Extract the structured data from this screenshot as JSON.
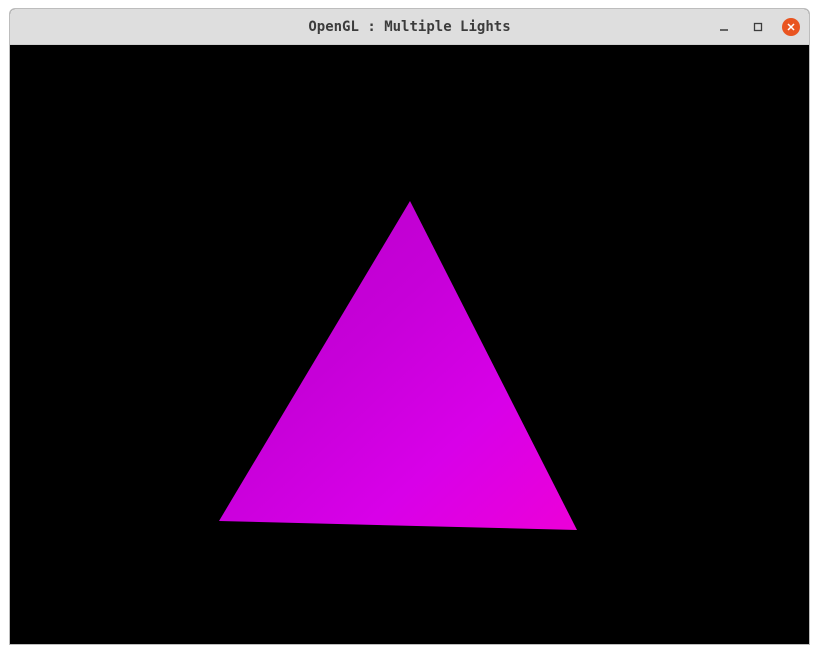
{
  "window": {
    "title": "OpenGL : Multiple Lights"
  },
  "controls": {
    "minimize_icon": "minimize-icon",
    "maximize_icon": "maximize-icon",
    "close_icon": "close-icon"
  },
  "scene": {
    "background_color": "#000000",
    "triangle_gradient": [
      "#b800c8",
      "#c600d8",
      "#d800e8",
      "#ec00d8"
    ]
  }
}
